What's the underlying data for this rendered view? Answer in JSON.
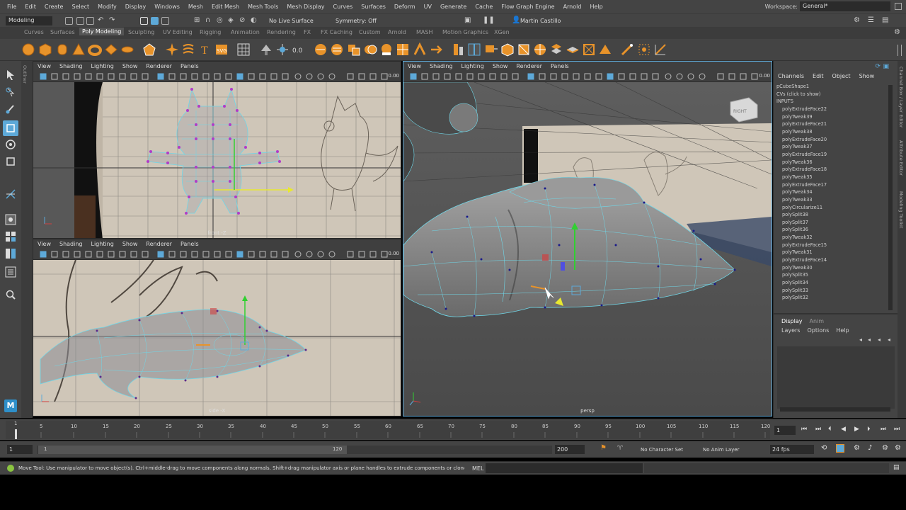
{
  "menu": {
    "items": [
      "File",
      "Edit",
      "Create",
      "Select",
      "Modify",
      "Display",
      "Windows",
      "Mesh",
      "Edit Mesh",
      "Mesh Tools",
      "Mesh Display",
      "Curves",
      "Surfaces",
      "Deform",
      "UV",
      "Generate",
      "Cache",
      "Flow Graph Engine",
      "Arnold",
      "Help"
    ],
    "workspace_label": "Workspace:",
    "workspace_value": "General*"
  },
  "status": {
    "mode": "Modeling",
    "live_surface": "No Live Surface",
    "symmetry": "Symmetry: Off",
    "user": "Martin Castillo"
  },
  "shelf_tabs": [
    "Curves",
    "Surfaces",
    "Poly Modeling",
    "Sculpting",
    "UV Editing",
    "Rigging",
    "Animation",
    "Rendering",
    "FX",
    "FX Caching",
    "Custom",
    "Arnold",
    "MASH",
    "Motion Graphics",
    "XGen"
  ],
  "shelf_active": "Poly Modeling",
  "outliner_label": "Outliner",
  "viewport_menu": [
    "View",
    "Shading",
    "Lighting",
    "Show",
    "Renderer",
    "Panels"
  ],
  "viewports": {
    "front": {
      "label": "front -Z",
      "value": "0.00"
    },
    "side": {
      "label": "side -X",
      "value": "0.00"
    },
    "persp": {
      "label": "persp",
      "value": "0.00",
      "cube_label": "RIGHT"
    }
  },
  "channel_box": {
    "menu": [
      "Channels",
      "Edit",
      "Object",
      "Show"
    ],
    "shape": "pCubeShape1",
    "cvs": "CVs (click to show)",
    "inputs_label": "INPUTS",
    "nodes": [
      "polyExtrudeFace22",
      "polyTweak39",
      "polyExtrudeFace21",
      "polyTweak38",
      "polyExtrudeFace20",
      "polyTweak37",
      "polyExtrudeFace19",
      "polyTweak36",
      "polyExtrudeFace18",
      "polyTweak35",
      "polyExtrudeFace17",
      "polyTweak34",
      "polyTweak33",
      "polyCircularize11",
      "polySplit38",
      "polySplit37",
      "polySplit36",
      "polyTweak32",
      "polyExtrudeFace15",
      "polyTweak31",
      "polyExtrudeFace14",
      "polyTweak30",
      "polySplit35",
      "polySplit34",
      "polySplit33",
      "polySplit32"
    ]
  },
  "side_tabs": [
    "Channel Box / Layer Editor",
    "Attribute Editor",
    "Modeling Toolkit"
  ],
  "layer_editor": {
    "tabs": [
      "Display",
      "Anim"
    ],
    "menu": [
      "Layers",
      "Options",
      "Help"
    ]
  },
  "timeline": {
    "ticks": [
      "1",
      "5",
      "10",
      "15",
      "20",
      "25",
      "30",
      "35",
      "40",
      "45",
      "50",
      "55",
      "60",
      "65",
      "70",
      "75",
      "80",
      "85",
      "90",
      "95",
      "100",
      "105",
      "110",
      "115",
      "120"
    ],
    "current_frame": "1"
  },
  "range": {
    "start": "1",
    "inner_start": "1",
    "inner_end": "120",
    "end": "200",
    "character_set": "No Character Set",
    "anim_layer": "No Anim Layer",
    "fps": "24 fps"
  },
  "help_line": {
    "text": "Move Tool: Use manipulator to move object(s). Ctrl+middle-drag to move components along normals. Shift+drag manipulator axis or plane handles to extrude components or clone objects. Ctrl+Shift+drag to const",
    "mel_label": "MEL"
  },
  "colors": {
    "accent": "#5da9d8",
    "wire": "#6fd7e8",
    "vertex": "#b03cc8",
    "shelf_orange": "#e8932a",
    "mesh_gray": "#8a8a8a"
  }
}
